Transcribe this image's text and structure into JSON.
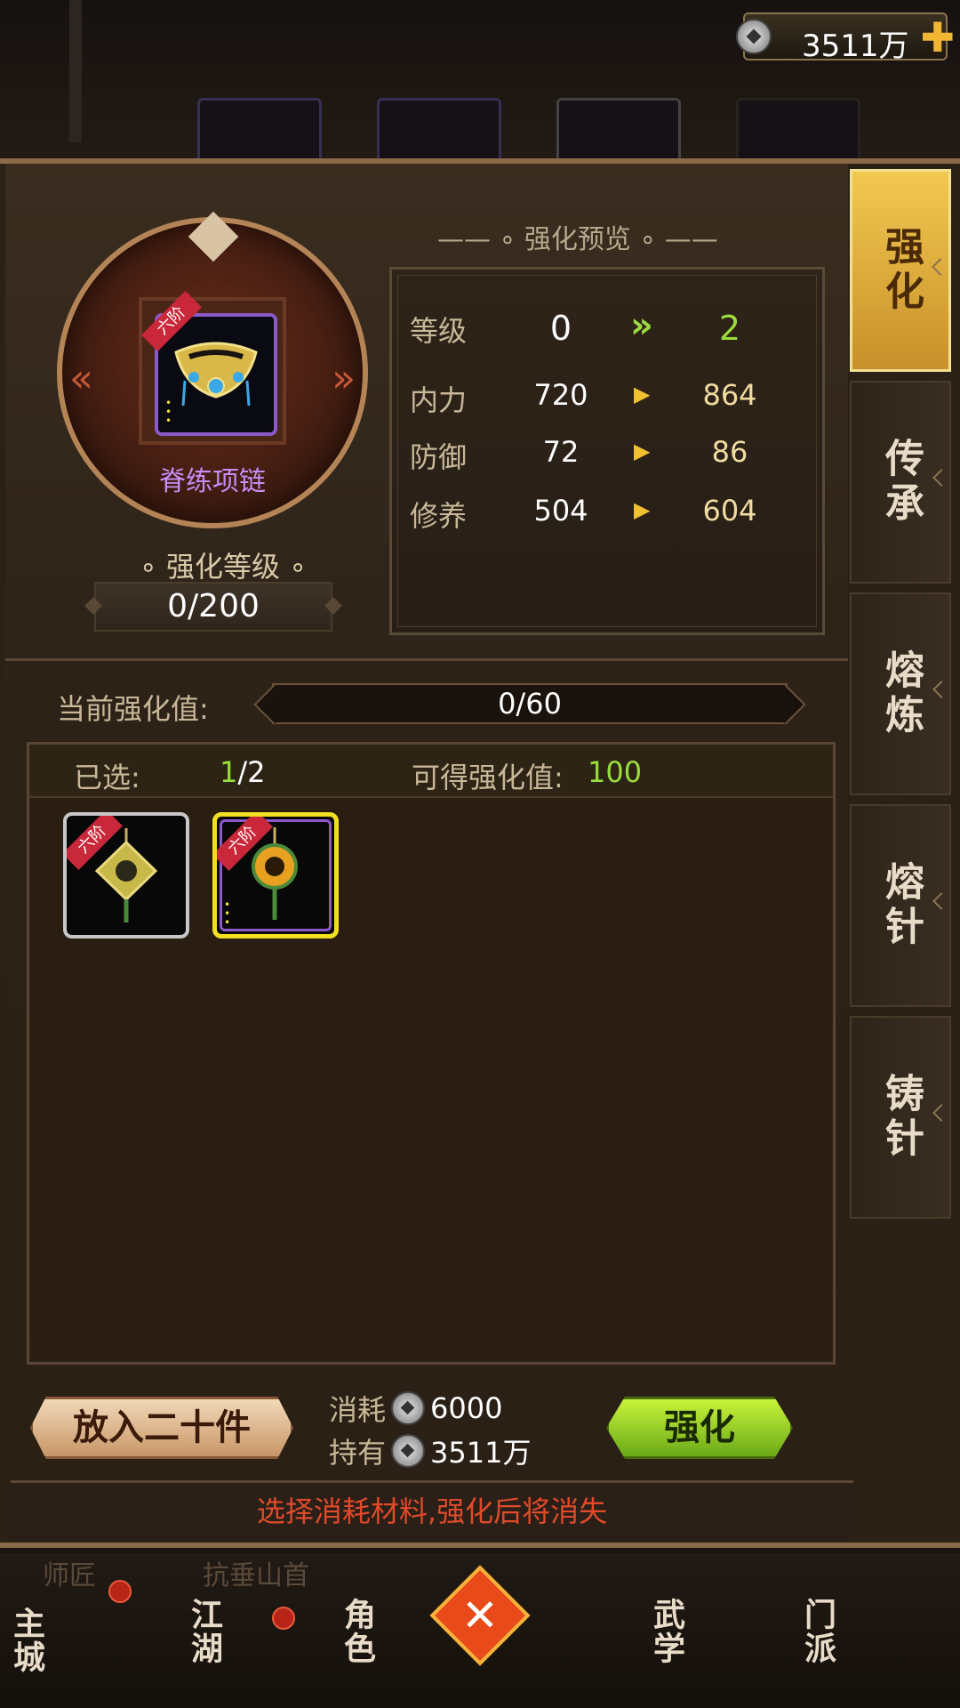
{
  "currency": {
    "amount": "3511万",
    "plus_icon": "plus-icon",
    "coin_icon": "silver-coin-icon"
  },
  "item": {
    "name": "脊练项链",
    "grade_badge": "六阶",
    "rarity_color": "#8a5ac8"
  },
  "level": {
    "title": "强化等级",
    "value": "0/200"
  },
  "preview": {
    "title": "强化预览",
    "rows": [
      {
        "name": "等级",
        "current": "0",
        "next": "2"
      },
      {
        "name": "内力",
        "current": "720",
        "next": "864"
      },
      {
        "name": "防御",
        "current": "72",
        "next": "86"
      },
      {
        "name": "修养",
        "current": "504",
        "next": "604"
      }
    ]
  },
  "strengthen": {
    "label": "当前强化值:",
    "value": "0/60"
  },
  "materials": {
    "selected_label": "已选:",
    "selected_count": "1",
    "selected_total": "/2",
    "gain_label": "可得强化值:",
    "gain_value": "100",
    "items": [
      {
        "grade_badge": "六阶",
        "selected": false
      },
      {
        "grade_badge": "六阶",
        "selected": true
      }
    ]
  },
  "actions": {
    "put_label": "放入二十件",
    "cost_label": "消耗",
    "cost_value": "6000",
    "own_label": "持有",
    "own_value": "3511万",
    "enhance_label": "强化"
  },
  "hint": "选择消耗材料,强化后将消失",
  "tabs": [
    {
      "label": "强化",
      "active": true
    },
    {
      "label": "传承",
      "active": false
    },
    {
      "label": "熔炼",
      "active": false
    },
    {
      "label": "熔针",
      "active": false
    },
    {
      "label": "铸针",
      "active": false
    }
  ],
  "nav": {
    "items": [
      "主城",
      "江湖",
      "角色",
      "武学",
      "门派"
    ],
    "bg_labels": [
      "师匠",
      "抗垂山首"
    ]
  },
  "colors": {
    "accent_green": "#9adc3c",
    "warning_red": "#e04a2a",
    "gold": "#f2c850"
  }
}
